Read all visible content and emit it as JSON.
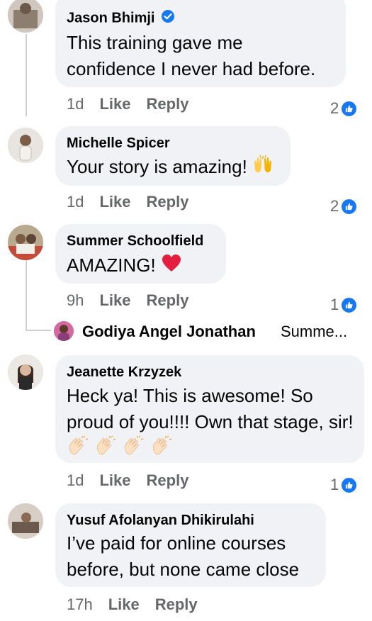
{
  "comments": [
    {
      "author": "Jason Bhimji",
      "verified": true,
      "lines": [
        "This training gave me",
        "confidence I never had before."
      ],
      "time": "1d",
      "like": "Like",
      "reply": "Reply",
      "reaction_count": "2"
    },
    {
      "author": "Michelle Spicer",
      "text": "Your story is amazing!",
      "time": "1d",
      "like": "Like",
      "reply": "Reply",
      "reaction_count": "2"
    },
    {
      "author": "Summer Schoolfield",
      "text": "AMAZING!",
      "time": "9h",
      "like": "Like",
      "reply": "Reply",
      "reaction_count": "1"
    },
    {
      "author": "Jeanette Krzyzek",
      "lines": [
        "Heck ya! This is awesome! So",
        "proud of you!!!! Own that stage, sir!"
      ],
      "time": "1d",
      "like": "Like",
      "reply": "Reply",
      "reaction_count": "1"
    },
    {
      "author": "Yusuf Afolanyan Dhikirulahi",
      "lines": [
        "I’ve paid for online courses",
        "before, but none came close"
      ],
      "time": "17h",
      "like": "Like",
      "reply": "Reply"
    }
  ],
  "reply_preview": {
    "author": "Godiya Angel Jonathan",
    "snippet": "Summe..."
  },
  "colors": {
    "bubble": "#f0f2f5",
    "meta": "#65676b",
    "like_blue": "#1877f2",
    "heart": "#e41e3f"
  },
  "icons": [
    "verified-badge-icon",
    "raising-hands-emoji",
    "red-heart-emoji",
    "clapping-hands-emoji",
    "like-thumb-icon"
  ]
}
